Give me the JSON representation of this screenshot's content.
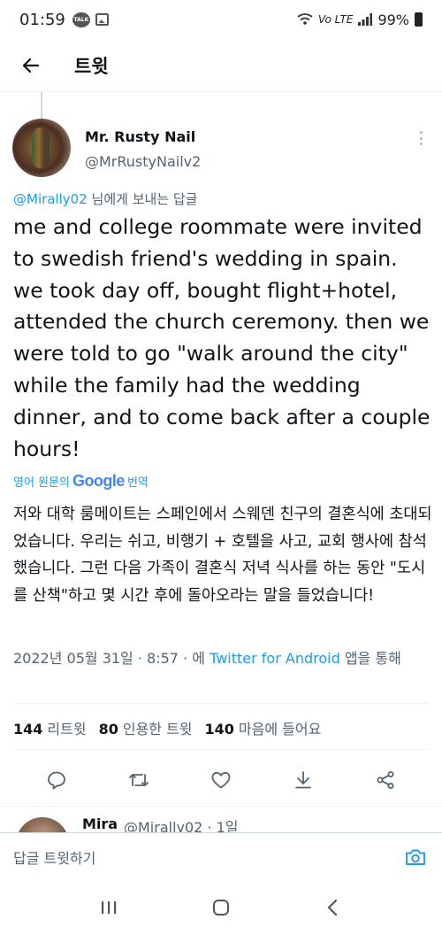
{
  "status_bar": {
    "time": "01:59",
    "talk_badge": "TALK",
    "volte": "Vo LTE",
    "battery": "99%"
  },
  "header": {
    "title": "트윗"
  },
  "tweet": {
    "author_name": "Mr. Rusty Nail",
    "author_handle": "@MrRustyNailv2",
    "reply_to_handle": "@Mirally02",
    "reply_to_suffix": " 님에게 보내는 답글",
    "text": "me and college roommate were invited to swedish friend's wedding in spain. we took day off, bought flight+hotel, attended the church ceremony. then we were told to go \"walk around the city\" while the family had the wedding dinner, and to come back after a couple hours!",
    "translate_prefix": "영어 원문의",
    "translate_brand": "Google",
    "translate_suffix": "번역",
    "translated_text": "저와 대학 룸메이트는 스페인에서 스웨덴 친구의 결혼식에 초대되었습니다. 우리는 쉬고, 비행기 + 호텔을 사고, 교회 행사에 참석했습니다. 그런 다음 가족이 결혼식 저녁 식사를 하는 동안 \"도시를 산책\"하고 몇 시간 후에 돌아오라는 말을 들었습니다!",
    "date": "2022년 05월 31일",
    "time": "8:57",
    "via_prefix": "에",
    "source": "Twitter for Android",
    "via_suffix": "앱을 통해",
    "retweets_count": "144",
    "retweets_label": "리트윗",
    "quotes_count": "80",
    "quotes_label": "인용한 트윗",
    "likes_count": "140",
    "likes_label": "마음에 들어요"
  },
  "next_reply": {
    "name": "Mira",
    "handle": "@Mirally02 · 1일"
  },
  "compose": {
    "placeholder": "답글 트윗하기"
  },
  "icons": {
    "back": "arrow-left-icon",
    "more": "more-vertical-icon",
    "reply": "reply-icon",
    "retweet": "retweet-icon",
    "like": "heart-icon",
    "bookmark": "download-icon",
    "share": "share-icon",
    "camera": "camera-icon",
    "nav_recents": "recents-icon",
    "nav_home": "home-icon",
    "nav_back": "back-icon"
  },
  "colors": {
    "link": "#1d9bf0",
    "text": "#0f1419",
    "muted": "#536471"
  }
}
